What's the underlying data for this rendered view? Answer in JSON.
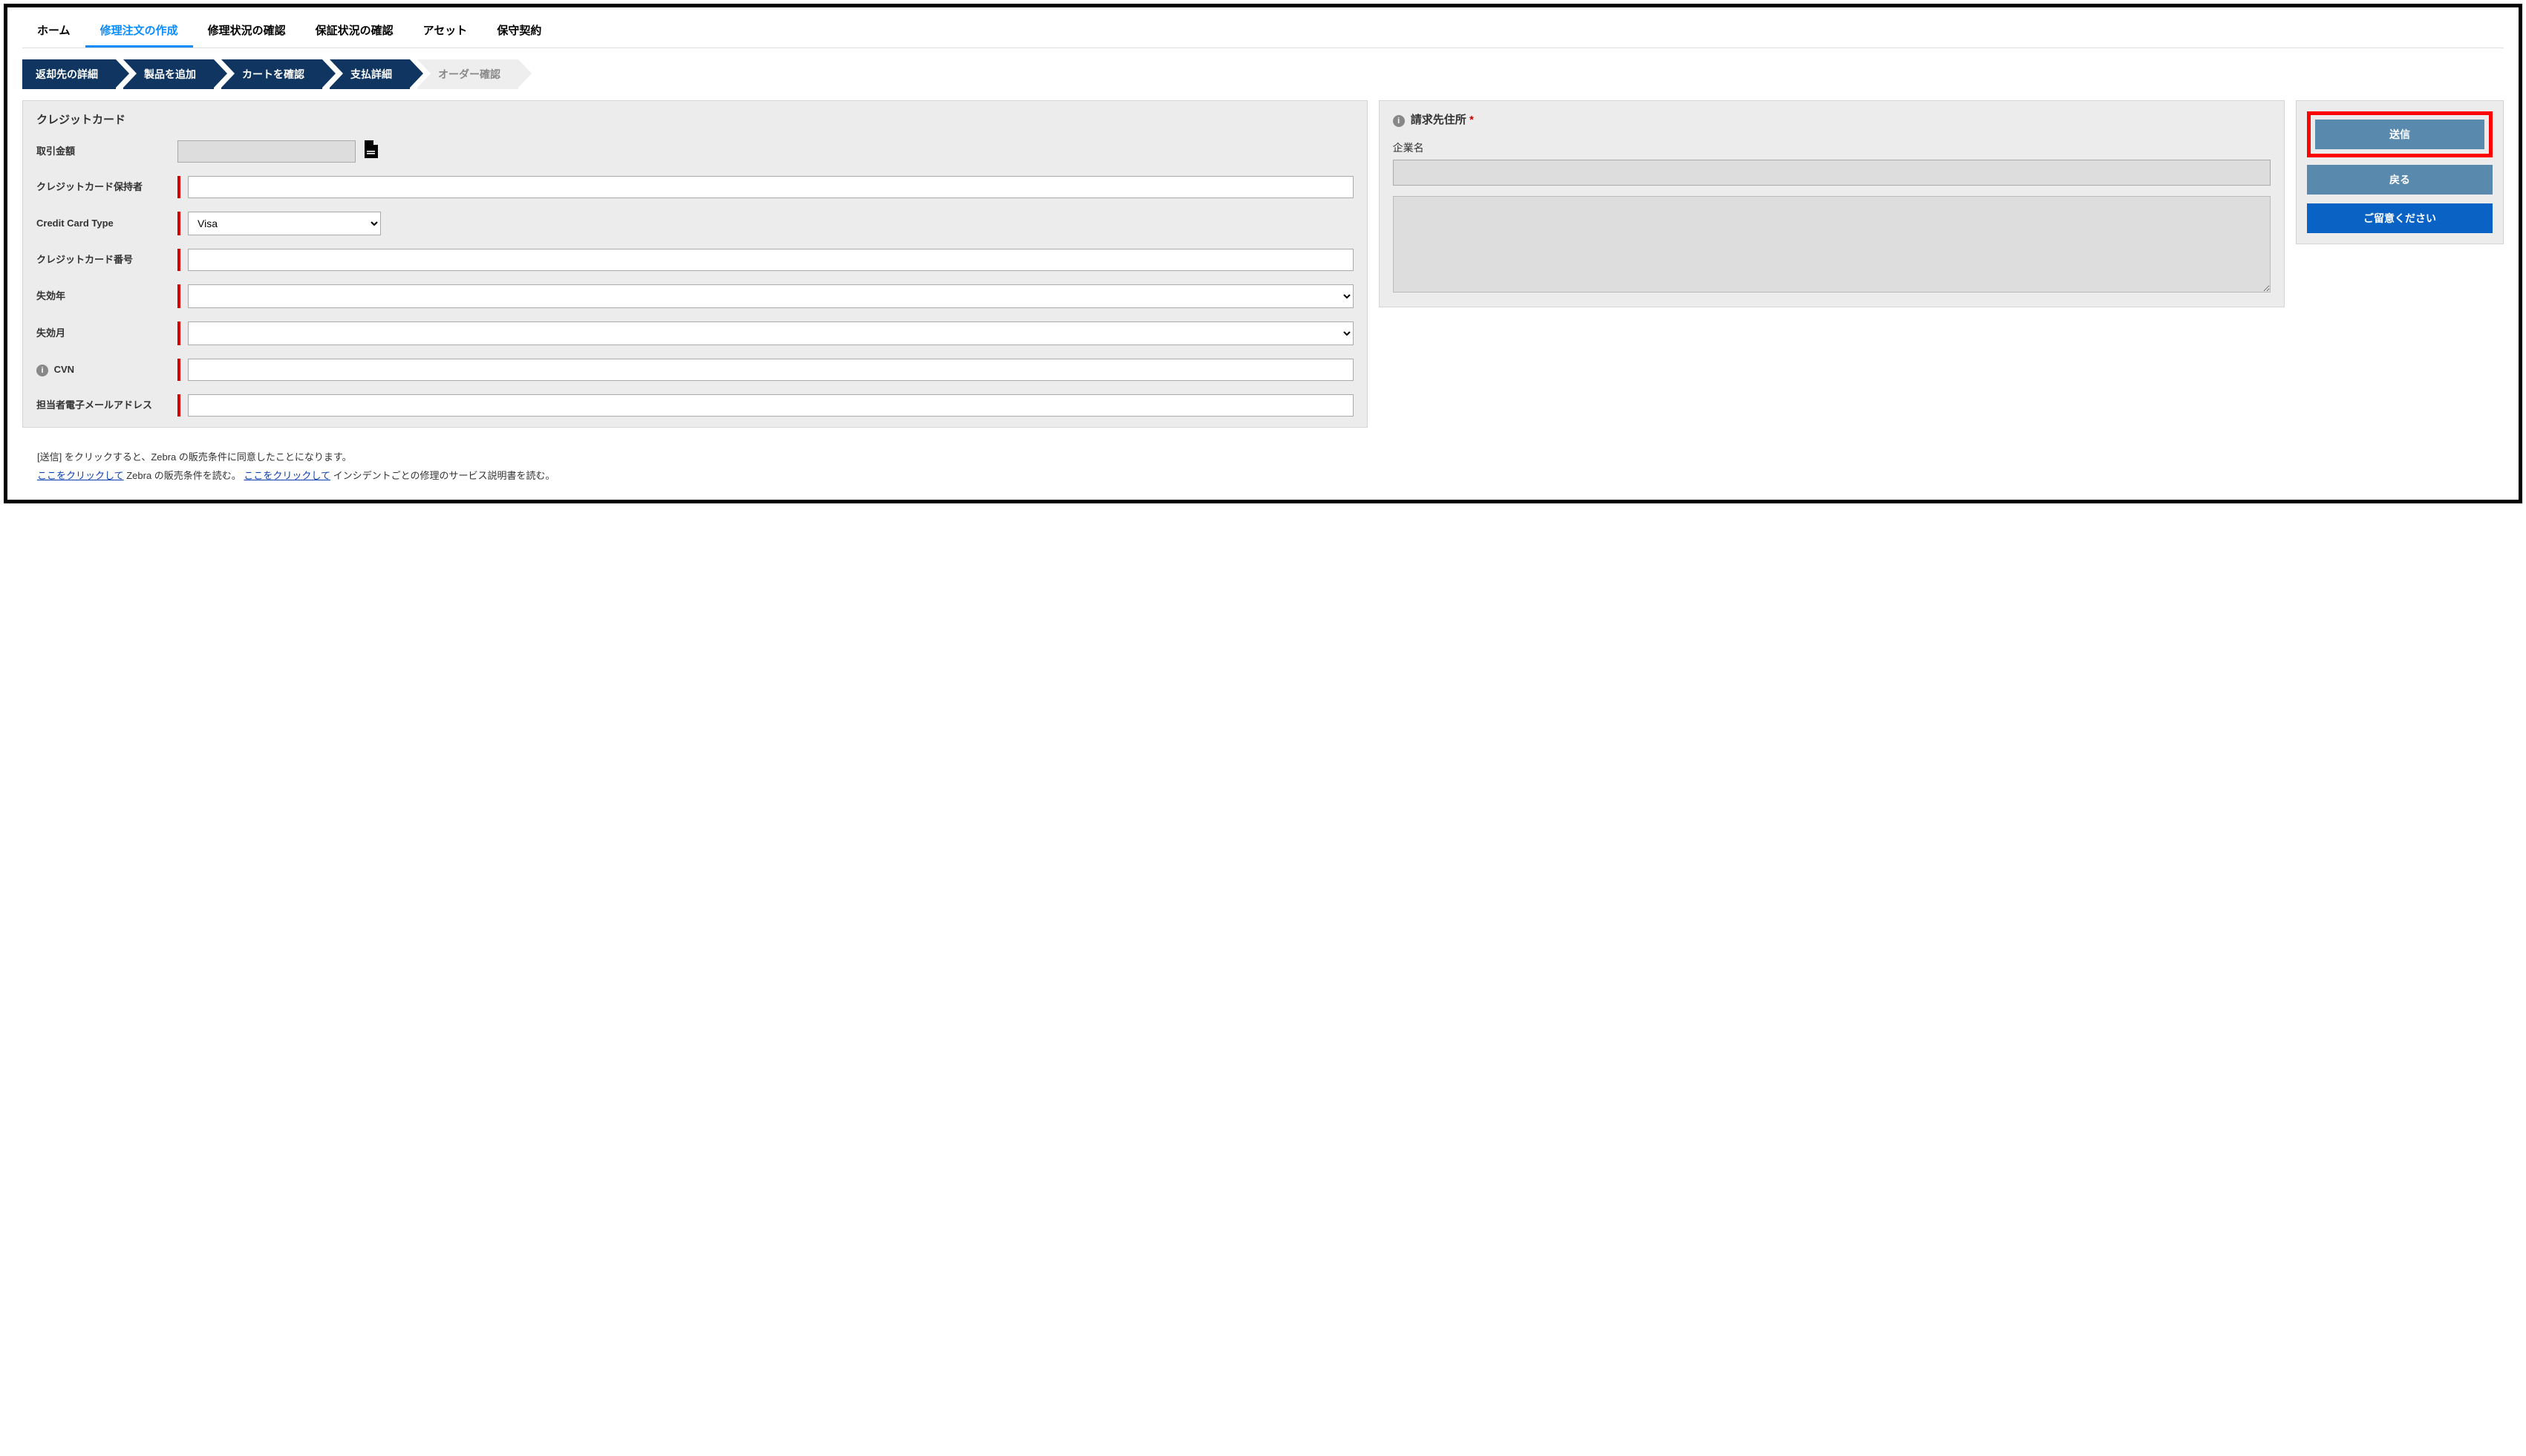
{
  "tabs": {
    "home": "ホーム",
    "createRepair": "修理注文の作成",
    "repairStatus": "修理状況の確認",
    "warrantyStatus": "保証状況の確認",
    "assets": "アセット",
    "contracts": "保守契約"
  },
  "steps": {
    "returnDetails": "返却先の詳細",
    "addProduct": "製品を追加",
    "checkCart": "カートを確認",
    "paymentDetails": "支払詳細",
    "orderConfirm": "オーダー確認"
  },
  "cc": {
    "title": "クレジットカード",
    "amountLabel": "取引金額",
    "amountValue": "",
    "holderLabel": "クレジットカード保持者",
    "holderValue": "",
    "typeLabel": "Credit Card Type",
    "typeValue": "Visa",
    "numberLabel": "クレジットカード番号",
    "numberValue": "",
    "expYearLabel": "失効年",
    "expYearValue": "",
    "expMonthLabel": "失効月",
    "expMonthValue": "",
    "cvnLabel": "CVN",
    "cvnValue": "",
    "emailLabel": "担当者電子メールアドレス",
    "emailValue": ""
  },
  "billing": {
    "title": "請求先住所",
    "companyLabel": "企業名",
    "companyValue": "",
    "addressValue": ""
  },
  "actions": {
    "submit": "送信",
    "back": "戻る",
    "note": "ご留意ください"
  },
  "footer": {
    "line1a": "[送信] をクリックすると、Zebra の販売条件に同意したことになります。",
    "link1": "ここをクリックして",
    "line2a": " Zebra の販売条件を読む。 ",
    "link2": "ここをクリックして",
    "line2b": " インシデントごとの修理のサービス説明書を読む。"
  },
  "icons": {
    "info": "i",
    "doc": "document-icon"
  }
}
